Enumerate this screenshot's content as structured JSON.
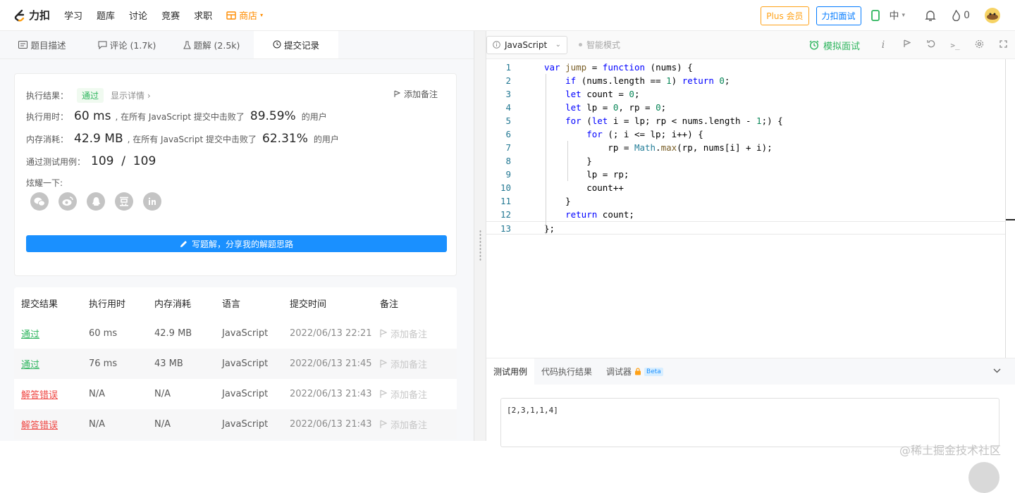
{
  "nav": {
    "logo_text": "力扣",
    "items": [
      "学习",
      "题库",
      "讨论",
      "竞赛",
      "求职"
    ],
    "shop_label": "商店",
    "plus_label": "Plus 会员",
    "interview_label": "力扣面试",
    "lang_label": "中",
    "points": "0"
  },
  "tabs": [
    {
      "label": "题目描述",
      "icon": "doc-icon"
    },
    {
      "label": "评论 (1.7k)",
      "icon": "comment-icon"
    },
    {
      "label": "题解 (2.5k)",
      "icon": "flask-icon"
    },
    {
      "label": "提交记录",
      "icon": "clock-icon"
    }
  ],
  "result": {
    "status_label": "执行结果：",
    "status_value": "通过",
    "details_link": "显示详情 ›",
    "add_note": "添加备注",
    "runtime_label": "执行用时：",
    "runtime_value": "60 ms",
    "runtime_mid": ", 在所有 JavaScript 提交中击败了",
    "runtime_pct": "89.59%",
    "runtime_suffix": "的用户",
    "memory_label": "内存消耗：",
    "memory_value": "42.9 MB",
    "memory_mid": ", 在所有 JavaScript 提交中击败了",
    "memory_pct": "62.31%",
    "memory_suffix": "的用户",
    "tests_label": "通过测试用例：",
    "tests_value": "109  /  109",
    "share_label": "炫耀一下:",
    "write_button": "写题解，分享我的解题思路"
  },
  "submissions": {
    "headers": [
      "提交结果",
      "执行用时",
      "内存消耗",
      "语言",
      "提交时间",
      "备注"
    ],
    "rows": [
      {
        "status": "通过",
        "ok": true,
        "time": "60 ms",
        "memory": "42.9 MB",
        "lang": "JavaScript",
        "date": "2022/06/13 22:21",
        "note": "添加备注"
      },
      {
        "status": "通过",
        "ok": true,
        "time": "76 ms",
        "memory": "43 MB",
        "lang": "JavaScript",
        "date": "2022/06/13 21:45",
        "note": "添加备注"
      },
      {
        "status": "解答错误",
        "ok": false,
        "time": "N/A",
        "memory": "N/A",
        "lang": "JavaScript",
        "date": "2022/06/13 21:43",
        "note": "添加备注"
      },
      {
        "status": "解答错误",
        "ok": false,
        "time": "N/A",
        "memory": "N/A",
        "lang": "JavaScript",
        "date": "2022/06/13 21:43",
        "note": "添加备注"
      }
    ]
  },
  "editor": {
    "language": "JavaScript",
    "smart_mode": "智能模式",
    "mock_interview": "模拟面试",
    "code_lines": [
      "var jump = function (nums) {",
      "    if (nums.length == 1) return 0;",
      "    let count = 0;",
      "    let lp = 0, rp = 0;",
      "    for (let i = lp; rp < nums.length - 1;) {",
      "        for (; i <= lp; i++) {",
      "            rp = Math.max(rp, nums[i] + i);",
      "        }",
      "        lp = rp;",
      "        count++",
      "    }",
      "    return count;",
      "};"
    ]
  },
  "console": {
    "tabs": [
      "测试用例",
      "代码执行结果",
      "调试器"
    ],
    "beta": "Beta",
    "testcase": "[2,3,1,1,4]"
  },
  "watermark": "@稀土掘金技术社区",
  "colors": {
    "accent": "#1a90ff",
    "success": "#2db55d",
    "error": "#ef4743",
    "plus": "#ffa116",
    "shop": "#ff8c00"
  }
}
